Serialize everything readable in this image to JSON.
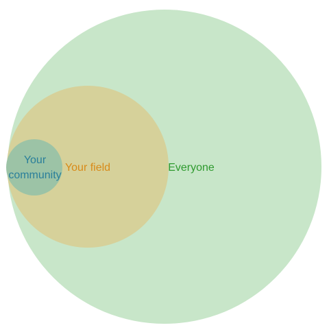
{
  "venn": {
    "circles": {
      "everyone": {
        "label": "Everyone",
        "fill": "#c8e6c9",
        "text_color": "#2e9a2e"
      },
      "field": {
        "label": "Your field",
        "fill": "#d6d19a",
        "text_color": "#d88a18"
      },
      "community": {
        "label_line1": "Your",
        "label_line2": "community",
        "fill": "#9cc3a6",
        "text_color": "#2a7f9a"
      }
    }
  }
}
